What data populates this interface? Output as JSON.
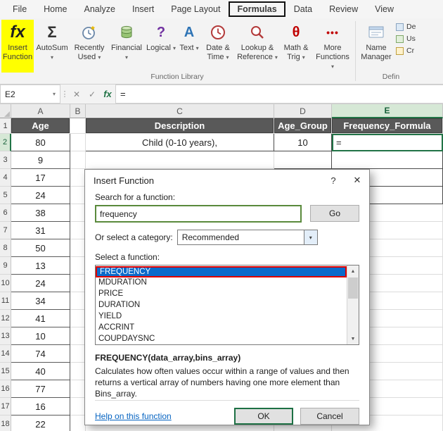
{
  "glyphs": {
    "dropdown": "▾",
    "cancel": "✕",
    "enter": "✓",
    "fx": "fx",
    "help": "?",
    "close": "✕",
    "scroll_up": "▲",
    "scroll_down": "▼",
    "dots": "⋮"
  },
  "colors": {
    "accent_green": "#217346",
    "highlight_yellow": "#ffff00",
    "selected_blue": "#0b6bcb",
    "annotation_red": "#e00000",
    "header_dark": "#595959"
  },
  "ribbon": {
    "tabs": [
      "File",
      "Home",
      "Analyze",
      "Insert",
      "Page Layout",
      "Formulas",
      "Data",
      "Review",
      "View"
    ],
    "active_tab": "Formulas",
    "function_library": {
      "group_label": "Function Library",
      "insert_function": {
        "icon_glyph": "fx",
        "label": "Insert Function"
      },
      "buttons": [
        {
          "label": "AutoSum",
          "glyph": "Σ"
        },
        {
          "label": "Recently Used"
        },
        {
          "label": "Financial"
        },
        {
          "label": "Logical",
          "glyph": "?"
        },
        {
          "label": "Text",
          "glyph": "A"
        },
        {
          "label": "Date & Time"
        },
        {
          "label": "Lookup & Reference"
        },
        {
          "label": "Math & Trig",
          "glyph": "θ"
        },
        {
          "label": "More Functions",
          "glyph": "•••"
        }
      ]
    },
    "defined_names": {
      "group_label": "Defin",
      "name_manager_label": "Name Manager",
      "small_buttons": [
        "De",
        "Us",
        "Cr"
      ]
    }
  },
  "formula_bar": {
    "name_box": "E2",
    "formula": "="
  },
  "grid": {
    "columns": [
      "A",
      "B",
      "C",
      "D",
      "E"
    ],
    "selected_column": "E",
    "selected_row": 2,
    "header_row": {
      "A": "Age",
      "B": "",
      "C": "Description",
      "D": "Age_Group",
      "E": "Frequency_Formula"
    },
    "ages": [
      80,
      9,
      17,
      24,
      38,
      31,
      50,
      13,
      24,
      34,
      41,
      10,
      74,
      40,
      77,
      16,
      22
    ],
    "row2": {
      "description": "Child (0-10 years),",
      "age_group": "10",
      "formula": "="
    }
  },
  "dialog": {
    "title": "Insert Function",
    "search_label": "Search for a function:",
    "search_value": "frequency",
    "go_label": "Go",
    "category_label": "Or select a category:",
    "category_value": "Recommended",
    "select_label": "Select a function:",
    "functions": [
      "FREQUENCY",
      "MDURATION",
      "PRICE",
      "DURATION",
      "YIELD",
      "ACCRINT",
      "COUPDAYSNC"
    ],
    "selected_function": "FREQUENCY",
    "signature": "FREQUENCY(data_array,bins_array)",
    "description": "Calculates how often values occur within a range of values and then returns a vertical array of numbers having one more element than Bins_array.",
    "help_link": "Help on this function",
    "ok_label": "OK",
    "cancel_label": "Cancel"
  }
}
